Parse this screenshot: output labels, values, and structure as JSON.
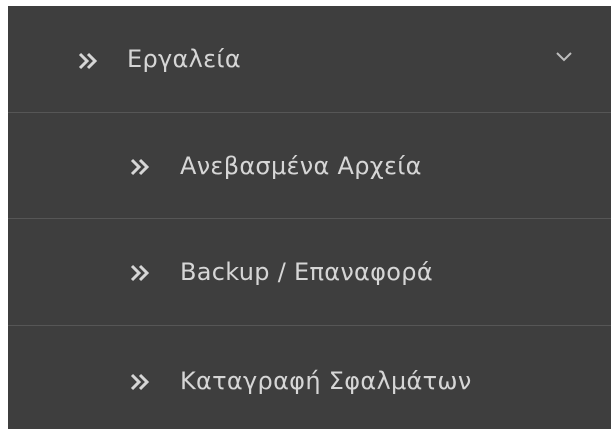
{
  "menu": {
    "parent": {
      "label": "Εργαλεία",
      "icon": "double-chevron-right-icon",
      "expanded_icon": "chevron-down-icon"
    },
    "children": [
      {
        "label": "Ανεβασμένα Αρχεία",
        "icon": "double-chevron-right-icon"
      },
      {
        "label": "Backup / Επαναφορά",
        "icon": "double-chevron-right-icon"
      },
      {
        "label": "Καταγραφή Σφαλμάτων",
        "icon": "double-chevron-right-icon"
      }
    ]
  },
  "colors": {
    "background": "#3e3e3e",
    "divider": "#565656",
    "text": "#d6d6d6",
    "icon": "#d6d6d6"
  }
}
